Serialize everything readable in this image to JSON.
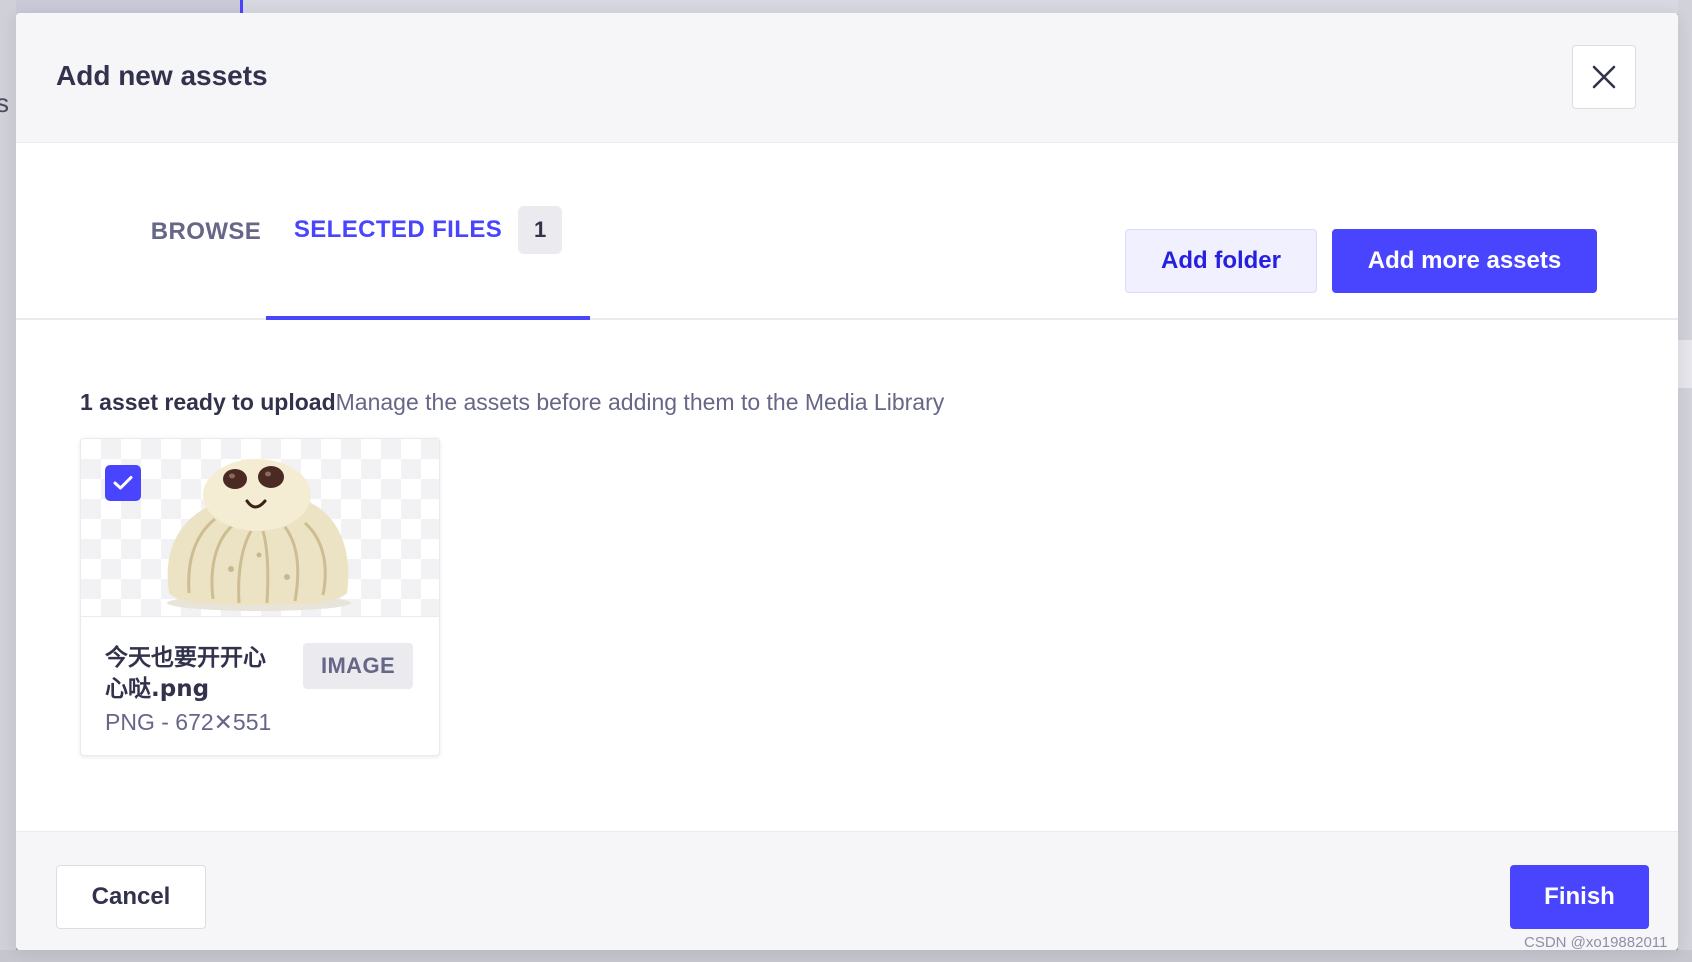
{
  "modal": {
    "title": "Add new assets"
  },
  "tabs": [
    {
      "label": "BROWSE"
    },
    {
      "label": "SELECTED FILES",
      "count": "1"
    }
  ],
  "actions": {
    "add_folder": "Add folder",
    "add_more_assets": "Add more assets"
  },
  "summary": {
    "count_text": "1 asset ready to upload",
    "help_text": "Manage the assets before adding them to the Media Library"
  },
  "assets": [
    {
      "name": "今天也要开开心心哒.png",
      "meta": "PNG - 672✕551",
      "type_badge": "IMAGE",
      "selected": true
    }
  ],
  "footer": {
    "cancel": "Cancel",
    "finish": "Finish"
  },
  "watermark": "CSDN @xo19882011",
  "colors": {
    "primary": "#4945ff",
    "primary_light": "#f0f0ff",
    "text_dark": "#32324d",
    "text_muted": "#666687",
    "surface": "#f6f6f9",
    "border": "#dcdce4"
  }
}
